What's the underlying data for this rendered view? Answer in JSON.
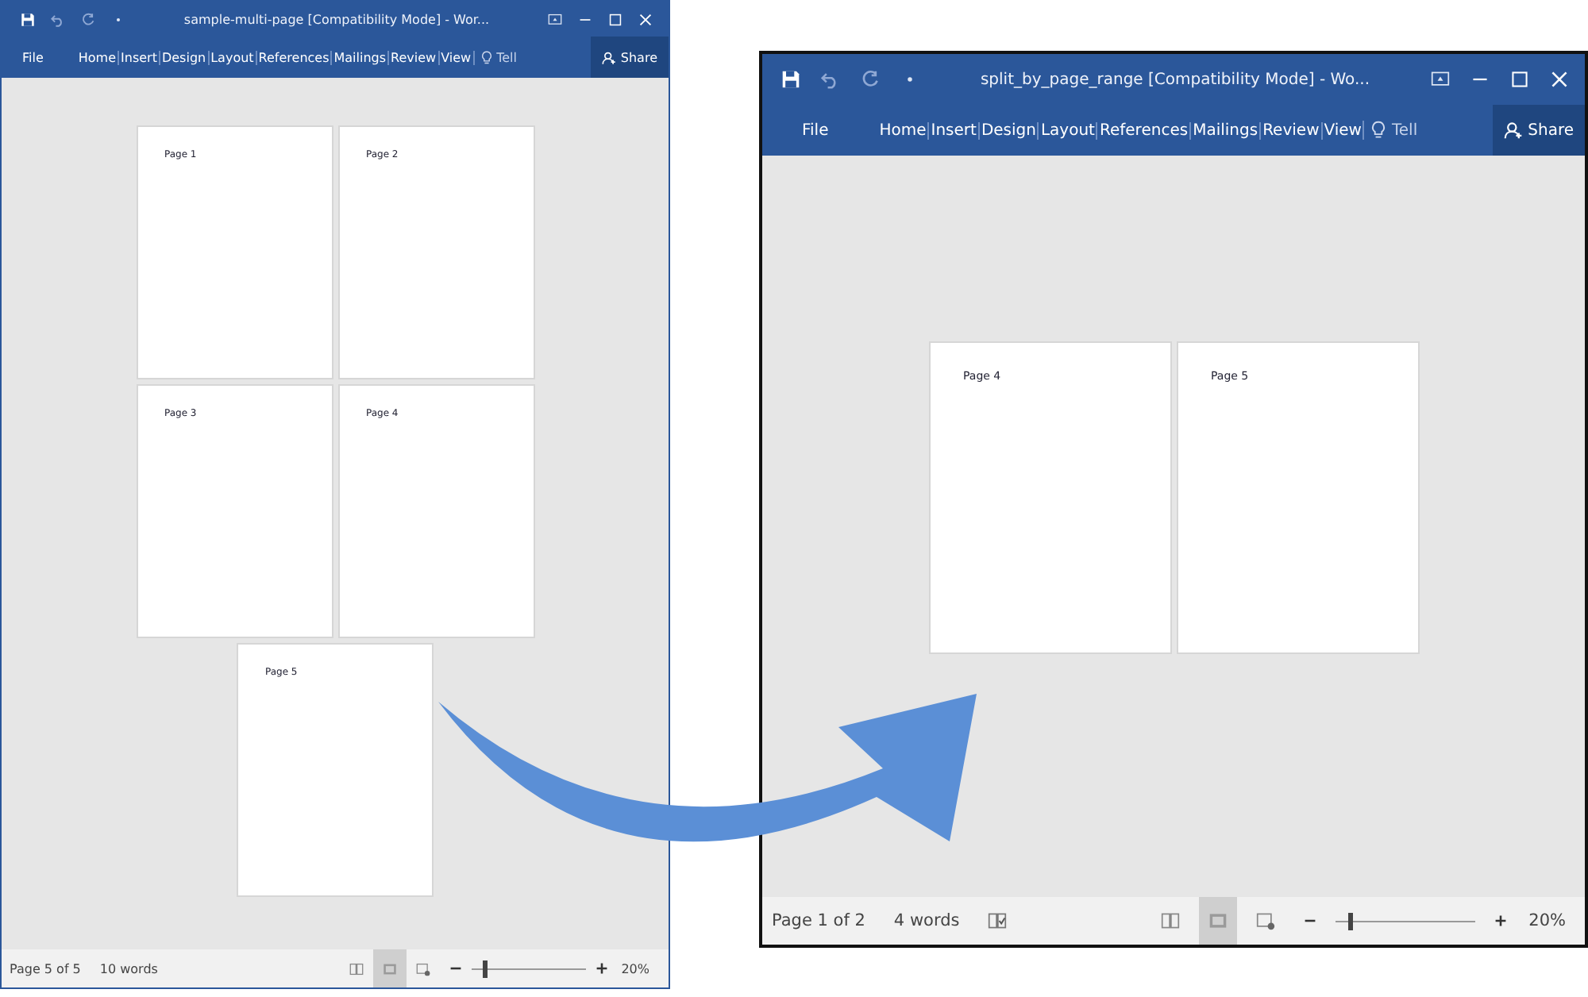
{
  "windows": [
    {
      "title": "sample-multi-page [Compatibility Mode] - Wor...",
      "tabs": [
        {
          "label": "File",
          "kind": "file"
        },
        {
          "label": "Home",
          "kind": "tab"
        },
        {
          "label": "Insert",
          "kind": "tab"
        },
        {
          "label": "Design",
          "kind": "tab"
        },
        {
          "label": "Layout",
          "kind": "tab"
        },
        {
          "label": "References",
          "kind": "tab"
        },
        {
          "label": "Mailings",
          "kind": "tab"
        },
        {
          "label": "Review",
          "kind": "tab"
        },
        {
          "label": "View",
          "kind": "tab"
        }
      ],
      "tell": "Tell",
      "share": "Share",
      "pages": [
        {
          "label": "Page 1"
        },
        {
          "label": "Page 2"
        },
        {
          "label": "Page 3"
        },
        {
          "label": "Page 4"
        },
        {
          "label": "Page 5"
        }
      ],
      "status": {
        "page": "Page 5 of 5",
        "words": "10 words",
        "proofing": false,
        "views": [
          {
            "kind": "read",
            "selected": false
          },
          {
            "kind": "print",
            "selected": true
          },
          {
            "kind": "web",
            "selected": false
          }
        ],
        "zoom": {
          "level": 0.1,
          "reading": "20%"
        }
      }
    },
    {
      "title": "split_by_page_range [Compatibility Mode] - Wo...",
      "tabs": [
        {
          "label": "File",
          "kind": "file"
        },
        {
          "label": "Home",
          "kind": "tab"
        },
        {
          "label": "Insert",
          "kind": "tab"
        },
        {
          "label": "Design",
          "kind": "tab"
        },
        {
          "label": "Layout",
          "kind": "tab"
        },
        {
          "label": "References",
          "kind": "tab"
        },
        {
          "label": "Mailings",
          "kind": "tab"
        },
        {
          "label": "Review",
          "kind": "tab"
        },
        {
          "label": "View",
          "kind": "tab"
        }
      ],
      "tell": "Tell",
      "share": "Share",
      "pages": [
        {
          "label": "Page 4"
        },
        {
          "label": "Page 5"
        }
      ],
      "status": {
        "page": "Page 1 of 2",
        "words": "4 words",
        "proofing": true,
        "views": [
          {
            "kind": "read",
            "selected": false
          },
          {
            "kind": "print",
            "selected": true
          },
          {
            "kind": "web",
            "selected": false
          }
        ],
        "zoom": {
          "level": 0.1,
          "reading": "20%"
        }
      }
    }
  ]
}
